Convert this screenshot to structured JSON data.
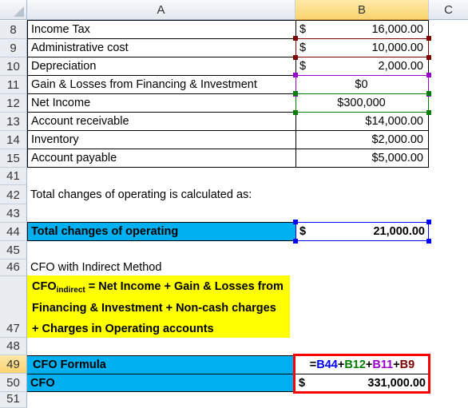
{
  "columns": [
    "A",
    "B",
    "C"
  ],
  "selected_column": "B",
  "rows_top": [
    {
      "row": "8",
      "label": "Income Tax",
      "cur": "$",
      "value": "16,000.00",
      "format": "accounting"
    },
    {
      "row": "9",
      "label": "Administrative cost",
      "cur": "$",
      "value": "10,000.00",
      "format": "accounting",
      "ref_color": "#7f0000"
    },
    {
      "row": "10",
      "label": "Depreciation",
      "cur": "$",
      "value": "2,000.00",
      "format": "accounting"
    },
    {
      "row": "11",
      "label": "Gain & Losses from Financing & Investment",
      "value": "$0",
      "format": "center",
      "ref_color": "#9900cc"
    },
    {
      "row": "12",
      "label": "Net Income",
      "value": "$300,000",
      "format": "center",
      "ref_color": "#008000"
    },
    {
      "row": "13",
      "label": "Account receivable",
      "value": "$14,000.00",
      "format": "right"
    },
    {
      "row": "14",
      "label": "Inventory",
      "value": "$2,000.00",
      "format": "right"
    },
    {
      "row": "15",
      "label": "Account payable",
      "value": "$5,000.00",
      "format": "right"
    }
  ],
  "row_numbers": {
    "r41": "41",
    "r42": "42",
    "r43": "43",
    "r44": "44",
    "r45": "45",
    "r46": "46",
    "r47": "47",
    "r48": "48",
    "r49": "49",
    "r50": "50",
    "r51": "51"
  },
  "note_42": "Total changes of operating  is calculated as:",
  "total_changes": {
    "label": "Total changes of operating",
    "cur": "$",
    "value": "21,000.00",
    "ref_color": "#0000ff"
  },
  "note_46": "CFO with Indirect Method",
  "formula_box": {
    "prefix": "CFO",
    "subscript": "indirect",
    "text": " = Net Income + Gain & Losses from Financing & Investment + Non-cash charges + Charges in Operating accounts"
  },
  "cfo_formula": {
    "label": "CFO Formula",
    "parts": [
      {
        "text": "=",
        "color": "#000000"
      },
      {
        "text": "B44",
        "color": "#0000ff"
      },
      {
        "text": "+",
        "color": "#000000"
      },
      {
        "text": "B12",
        "color": "#008000"
      },
      {
        "text": "+",
        "color": "#000000"
      },
      {
        "text": "B11",
        "color": "#9900cc"
      },
      {
        "text": "+",
        "color": "#000000"
      },
      {
        "text": "B9",
        "color": "#7f0000"
      }
    ]
  },
  "cfo": {
    "label": "CFO",
    "cur": "$",
    "value": "331,000.00"
  },
  "colors": {
    "highlight_blue": "#00b0f0",
    "highlight_yellow": "#ffff00",
    "result_border": "#ff0000"
  }
}
